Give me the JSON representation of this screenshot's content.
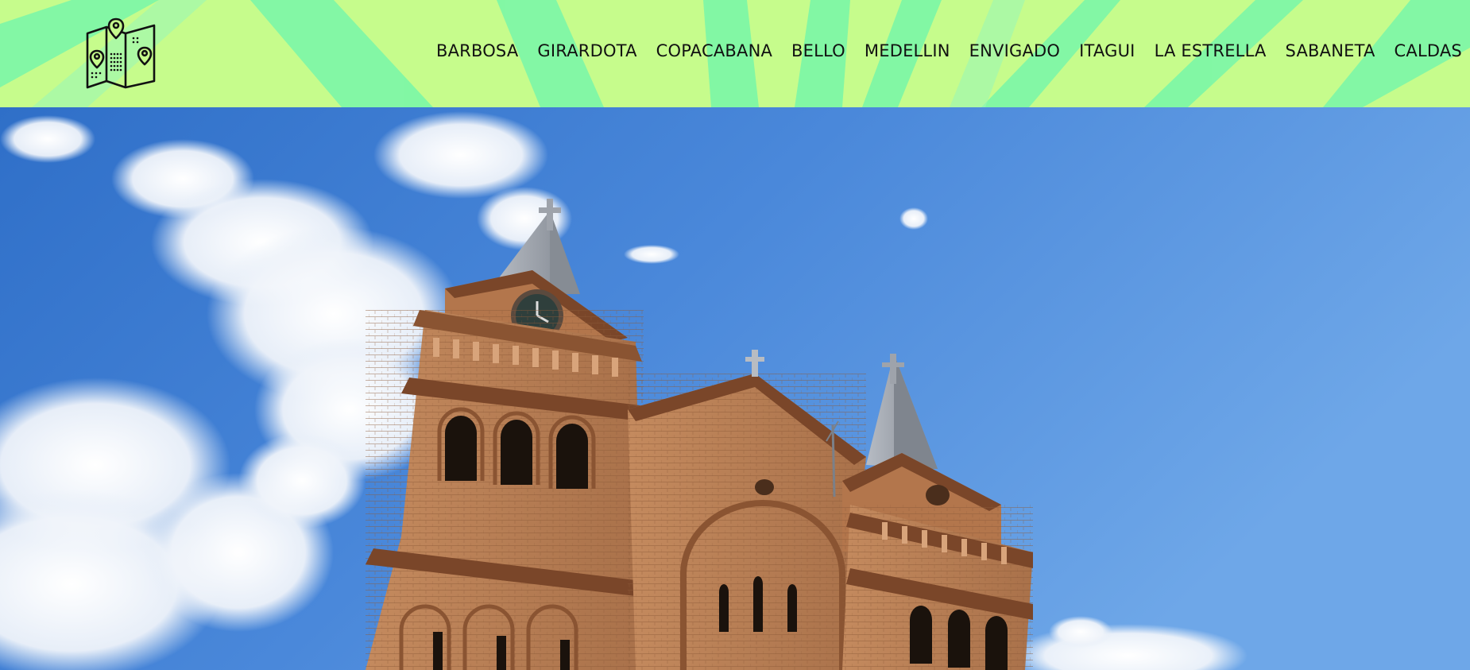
{
  "header": {
    "logo_icon": "folded-map-with-pins-icon",
    "colors": {
      "light_stripe": "#c6fc8c",
      "dark_stripe": "#7ff7a6"
    },
    "nav": [
      {
        "label": "BARBOSA"
      },
      {
        "label": "GIRARDOTA"
      },
      {
        "label": "COPACABANA"
      },
      {
        "label": "BELLO"
      },
      {
        "label": "MEDELLIN"
      },
      {
        "label": "ENVIGADO"
      },
      {
        "label": "ITAGUI"
      },
      {
        "label": "LA ESTRELLA"
      },
      {
        "label": "SABANETA"
      },
      {
        "label": "CALDAS"
      }
    ]
  },
  "hero": {
    "subject": "brick-church-towers-against-blue-sky",
    "colors": {
      "sky_top": "#3f7fd4",
      "sky_bottom": "#6aa3e6",
      "brick": "#b97c52",
      "brick_dark": "#7c4a2c",
      "roof": "#9aa0a8"
    }
  }
}
